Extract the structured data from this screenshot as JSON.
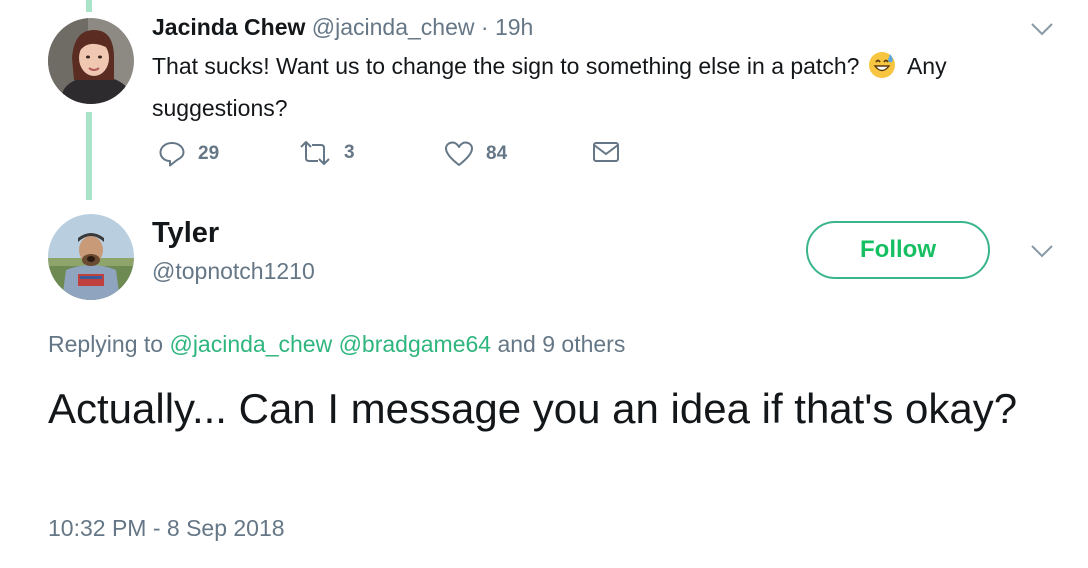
{
  "tweet1": {
    "name": "Jacinda Chew",
    "handle": "@jacinda_chew",
    "separator": "·",
    "time": "19h",
    "text_part1": "That sucks!  Want us to change the sign to something else in a patch?",
    "emoji": "grinning-face-with-sweat",
    "text_part2": "Any",
    "text_line2": "suggestions?",
    "reply_count": "29",
    "retweet_count": "3",
    "like_count": "84"
  },
  "tweet2": {
    "name": "Tyler",
    "handle": "@topnotch1210",
    "follow_label": "Follow",
    "replying_prefix": "Replying to",
    "mention1": "@jacinda_chew",
    "mention2": "@bradgame64",
    "replying_suffix": "and 9 others",
    "text": "Actually... Can I message you an idea if that's okay?",
    "timestamp": "10:32 PM - 8 Sep 2018"
  },
  "colors": {
    "accent_green": "#17bf63",
    "thread_line": "#a9e3c8",
    "secondary_text": "#657786"
  }
}
